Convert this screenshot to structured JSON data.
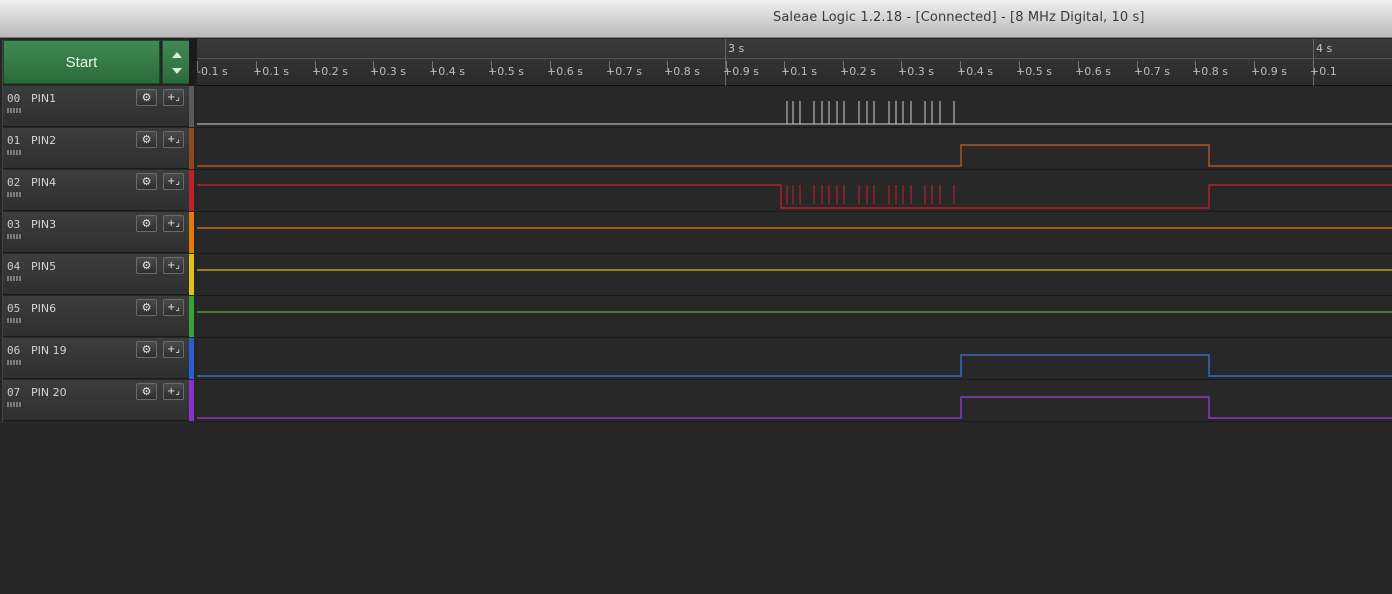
{
  "window": {
    "title": "Saleae Logic 1.2.18 - [Connected] - [8 MHz Digital, 10 s]"
  },
  "toolbar": {
    "start_label": "Start"
  },
  "ruler": {
    "major_labels": [
      {
        "text": "3 s"
      },
      {
        "text": "4 s"
      }
    ],
    "tick_labels": [
      "+0.1 s",
      "+0.2 s",
      "+0.3 s",
      "+0.4 s",
      "+0.5 s",
      "+0.6 s",
      "+0.7 s",
      "+0.8 s",
      "+0.9 s",
      "+0.1 s",
      "+0.2 s",
      "+0.3 s",
      "+0.4 s",
      "+0.5 s",
      "+0.6 s",
      "+0.7 s",
      "+0.8 s",
      "+0.9 s",
      "+0.1"
    ],
    "first_tick_label": "-0.1 s"
  },
  "channels": [
    {
      "num": "00",
      "name": "PIN1",
      "color": "#5a5a5a",
      "wave_color": "#d0d0d0"
    },
    {
      "num": "01",
      "name": "PIN2",
      "color": "#8b4a1f",
      "wave_color": "#c8621c"
    },
    {
      "num": "02",
      "name": "PIN4",
      "color": "#c0202a",
      "wave_color": "#d0202a"
    },
    {
      "num": "03",
      "name": "PIN3",
      "color": "#e07a10",
      "wave_color": "#e07a10"
    },
    {
      "num": "04",
      "name": "PIN5",
      "color": "#e0c020",
      "wave_color": "#d8b818"
    },
    {
      "num": "05",
      "name": "PIN6",
      "color": "#3aa03a",
      "wave_color": "#6aa82a"
    },
    {
      "num": "06",
      "name": "PIN 19",
      "color": "#2a5ed0",
      "wave_color": "#3a78e0"
    },
    {
      "num": "07",
      "name": "PIN 20",
      "color": "#8a30c8",
      "wave_color": "#a040e0"
    }
  ],
  "icons": {
    "settings": "gear-icon",
    "add_analyzer": "add-analyzer-icon",
    "spin_up": "arrow-up-icon",
    "spin_down": "arrow-down-icon"
  }
}
